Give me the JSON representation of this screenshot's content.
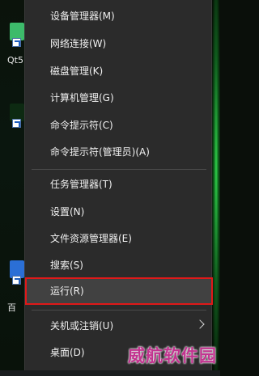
{
  "desktop": {
    "icons": [
      {
        "name": "qt-icon",
        "label": "Qt5"
      },
      {
        "name": "app-icon-2",
        "label": ""
      },
      {
        "name": "baidu-icon",
        "label": "百"
      }
    ]
  },
  "menu": {
    "items": [
      {
        "label": "设备管理器(M)"
      },
      {
        "label": "网络连接(W)"
      },
      {
        "label": "磁盘管理(K)"
      },
      {
        "label": "计算机管理(G)"
      },
      {
        "label": "命令提示符(C)"
      },
      {
        "label": "命令提示符(管理员)(A)"
      },
      {
        "label": "任务管理器(T)"
      },
      {
        "label": "设置(N)"
      },
      {
        "label": "文件资源管理器(E)"
      },
      {
        "label": "搜索(S)"
      },
      {
        "label": "运行(R)"
      },
      {
        "label": "关机或注销(U)"
      },
      {
        "label": "桌面(D)"
      }
    ]
  },
  "watermark": "威航软件园",
  "colors": {
    "menu_bg": "#2b2b2b",
    "highlight_border": "#e01919",
    "watermark": "#c2338f"
  }
}
